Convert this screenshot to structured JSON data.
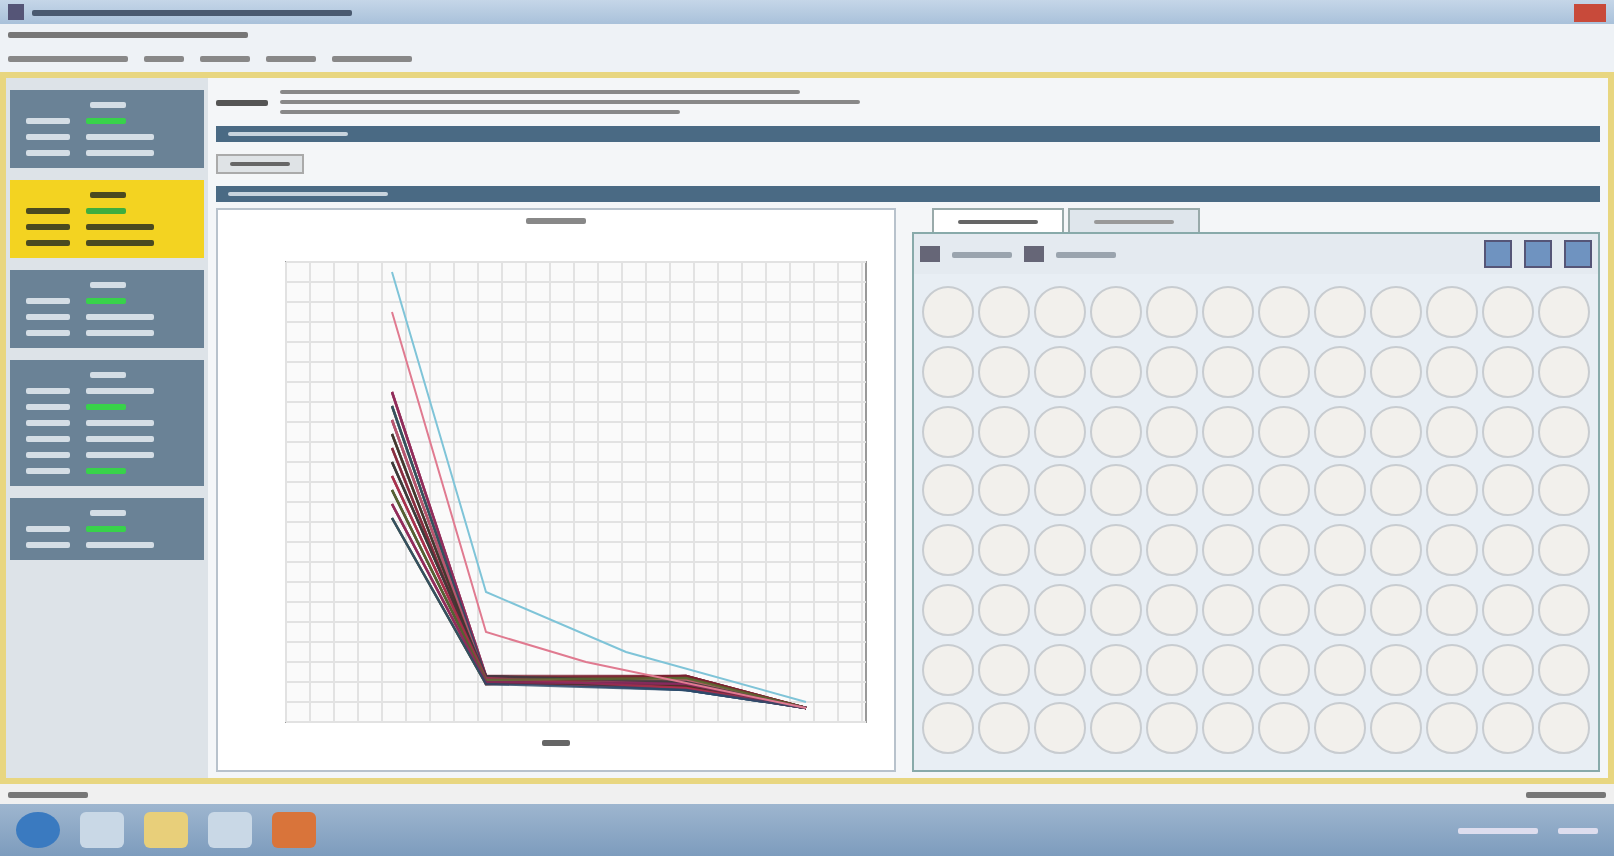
{
  "sidebar": {
    "cards": [
      {
        "selected": false,
        "rows": [
          {
            "kind": "heading"
          },
          {
            "kind": "status"
          },
          {
            "kind": "plain"
          },
          {
            "kind": "plain"
          }
        ]
      },
      {
        "selected": true,
        "rows": [
          {
            "kind": "heading"
          },
          {
            "kind": "status"
          },
          {
            "kind": "plain"
          },
          {
            "kind": "plain"
          }
        ]
      },
      {
        "selected": false,
        "rows": [
          {
            "kind": "heading"
          },
          {
            "kind": "status"
          },
          {
            "kind": "plain"
          },
          {
            "kind": "plain"
          }
        ]
      },
      {
        "selected": false,
        "rows": [
          {
            "kind": "heading"
          },
          {
            "kind": "plain"
          },
          {
            "kind": "status"
          },
          {
            "kind": "plain"
          },
          {
            "kind": "plain"
          },
          {
            "kind": "plain"
          },
          {
            "kind": "status"
          }
        ]
      },
      {
        "selected": false,
        "rows": [
          {
            "kind": "heading"
          },
          {
            "kind": "status"
          },
          {
            "kind": "plain"
          }
        ]
      }
    ]
  },
  "plate_tabs": [
    {
      "selected": true
    },
    {
      "selected": false
    }
  ]
}
